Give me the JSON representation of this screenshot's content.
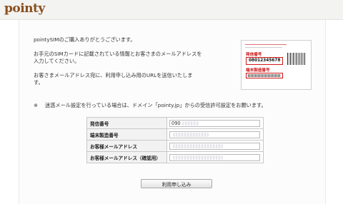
{
  "header": {
    "logo": "pointy"
  },
  "intro": {
    "line1": "pointySIMのご購入ありがとうございます。",
    "line2a": "お手元のSIMカードに記載されている情報とお客さまのメールアドレスを",
    "line2b": "入力してください。",
    "line3a": "お客さまメールアドレス宛に、利用申し込み用のURLを送信いたしま",
    "line3b": "す。"
  },
  "card": {
    "label_phone": "発信番号",
    "phone_number": "08012345678",
    "label_serial": "端末製造番号"
  },
  "note": {
    "mark": "※",
    "text": "迷惑メール設定を行っている場合は、ドメイン「pointy.jp」からの受信許可設定をお願います。"
  },
  "form": {
    "rows": [
      {
        "label": "発信番号",
        "value": "090"
      },
      {
        "label": "端末製造番号",
        "value": ""
      },
      {
        "label": "お客様メールアドレス",
        "value": ""
      },
      {
        "label": "お客様メールアドレス（確認用）",
        "value": ""
      }
    ],
    "submit_label": "利用申し込み"
  }
}
